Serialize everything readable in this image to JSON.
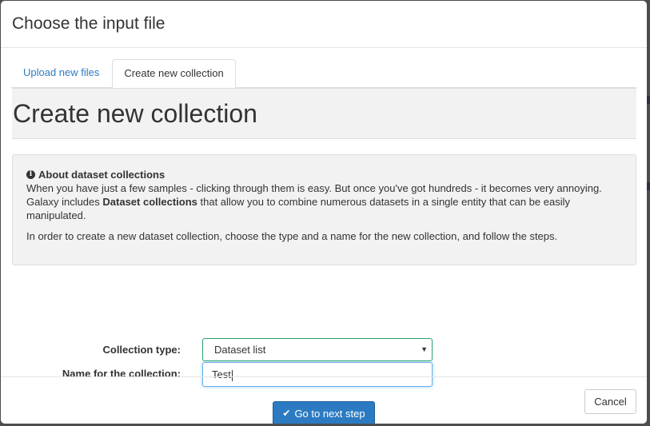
{
  "modal": {
    "title": "Choose the input file"
  },
  "tabs": [
    {
      "label": "Upload new files",
      "active": false
    },
    {
      "label": "Create new collection",
      "active": true
    }
  ],
  "panel": {
    "heading": "Create new collection"
  },
  "info": {
    "icon": "info-circle-icon",
    "heading": "About dataset collections",
    "line1": "When you have just a few samples - clicking through them is easy. But once you've got hundreds - it becomes very annoying.",
    "line2_pre": "Galaxy includes ",
    "line2_bold": "Dataset collections",
    "line2_post": " that allow you to combine numerous datasets in a single entity that can be easily manipulated.",
    "para2": "In order to create a new dataset collection, choose the type and a name for the new collection, and follow the steps."
  },
  "form": {
    "collection_type_label": "Collection type:",
    "collection_type_value": "Dataset list",
    "collection_name_label": "Name for the collection:",
    "collection_name_value": "Test"
  },
  "buttons": {
    "next_label": "Go to next step",
    "next_icon": "check-icon",
    "cancel_label": "Cancel"
  },
  "colors": {
    "primary": "#2c7bc2",
    "select_border": "#25a368",
    "focus_border": "#66afe9"
  }
}
